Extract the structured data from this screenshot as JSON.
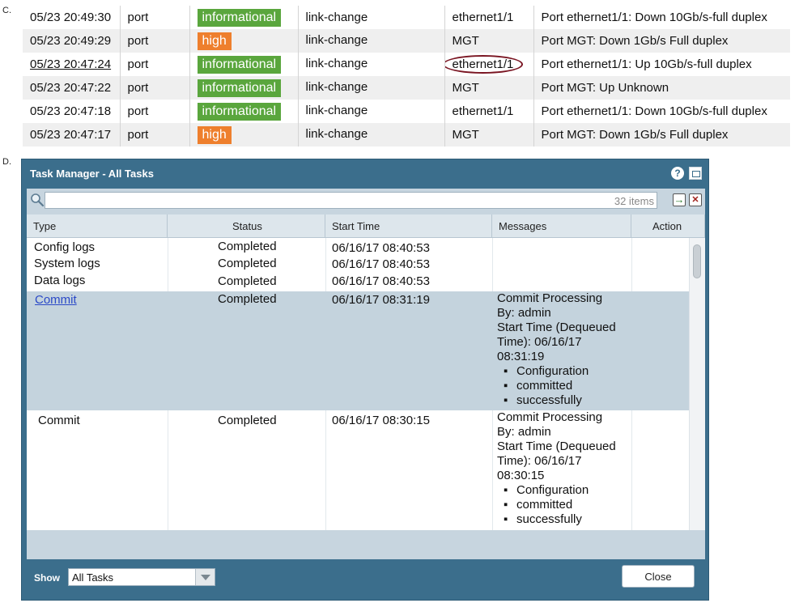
{
  "section_c": {
    "label": "C.",
    "rows": [
      {
        "time": "05/23 20:49:30",
        "type": "port",
        "severity": "informational",
        "event": "link-change",
        "object": "ethernet1/1",
        "description": "Port ethernet1/1: Down 10Gb/s-full duplex"
      },
      {
        "time": "05/23 20:49:29",
        "type": "port",
        "severity": "high",
        "event": "link-change",
        "object": "MGT",
        "description": "Port MGT: Down 1Gb/s Full duplex"
      },
      {
        "time": "05/23 20:47:24",
        "type": "port",
        "severity": "informational",
        "event": "link-change",
        "object": "ethernet1/1",
        "description": "Port ethernet1/1: Up 10Gb/s-full duplex"
      },
      {
        "time": "05/23 20:47:22",
        "type": "port",
        "severity": "informational",
        "event": "link-change",
        "object": "MGT",
        "description": "Port MGT: Up Unknown"
      },
      {
        "time": "05/23 20:47:18",
        "type": "port",
        "severity": "informational",
        "event": "link-change",
        "object": "ethernet1/1",
        "description": "Port ethernet1/1: Down 10Gb/s-full duplex"
      },
      {
        "time": "05/23 20:47:17",
        "type": "port",
        "severity": "high",
        "event": "link-change",
        "object": "MGT",
        "description": "Port MGT: Down 1Gb/s Full duplex"
      }
    ],
    "colors": {
      "informational": "#5aa63d",
      "high": "#ee7f2d",
      "highlight_circle": "#7a1522"
    }
  },
  "section_d": {
    "label": "D.",
    "window_title": "Task Manager - All Tasks",
    "help_icon": "?",
    "search": {
      "value": "",
      "placeholder": ""
    },
    "item_count": "32 items",
    "columns": [
      "Type",
      "Status",
      "Start Time",
      "Messages",
      "Action"
    ],
    "rows": [
      {
        "type": "Config logs",
        "status": "Completed",
        "start_time": "06/16/17 08:40:53"
      },
      {
        "type": "System logs",
        "status": "Completed",
        "start_time": "06/16/17 08:40:53"
      },
      {
        "type": "Data logs",
        "status": "Completed",
        "start_time": "06/16/17 08:40:53"
      },
      {
        "type": "Commit",
        "status": "Completed",
        "start_time": "06/16/17 08:31:19",
        "messages": [
          "Commit Processing",
          "By: admin",
          "Start Time (Dequeued",
          "Time): 06/16/17",
          "08:31:19"
        ],
        "bullets": [
          "Configuration",
          "committed",
          "successfully"
        ]
      },
      {
        "type": "Commit",
        "status": "Completed",
        "start_time": "06/16/17 08:30:15",
        "messages": [
          "Commit Processing",
          "By: admin",
          "Start Time (Dequeued",
          "Time): 06/16/17",
          "08:30:15"
        ],
        "bullets": [
          "Configuration",
          "committed",
          "successfully"
        ]
      }
    ],
    "footer": {
      "show_label": "Show",
      "show_value": "All Tasks",
      "close_label": "Close"
    },
    "colors": {
      "window": "#3b6e8c",
      "selected_row": "#c4d3dd",
      "link": "#2b49c7"
    }
  }
}
